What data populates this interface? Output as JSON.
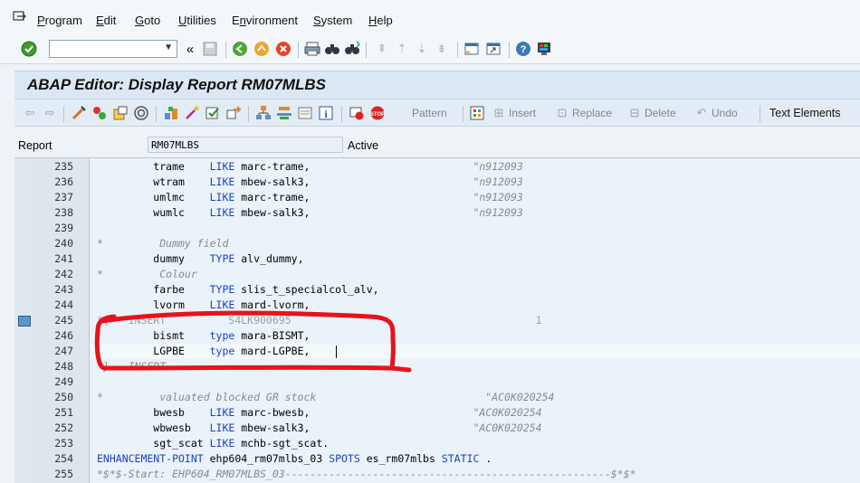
{
  "menubar": {
    "items": [
      "Program",
      "Edit",
      "Goto",
      "Utilities",
      "Environment",
      "System",
      "Help"
    ],
    "underlines": [
      "P",
      "E",
      "G",
      "U",
      "n",
      "S",
      "H"
    ]
  },
  "toolbar1": {
    "command_field": {
      "value": "",
      "placeholder": ""
    },
    "icons": [
      "enter-icon",
      "save-icon",
      "back-icon",
      "exit-icon",
      "cancel-icon",
      "print-icon",
      "find-icon",
      "find-next-icon",
      "first-page-icon",
      "prev-page-icon",
      "next-page-icon",
      "last-page-icon",
      "new-session-icon",
      "shortcut-icon",
      "help-icon",
      "customize-layout-icon"
    ]
  },
  "title": "ABAP Editor: Display Report RM07MLBS",
  "toolbar2": {
    "pattern_label": "Pattern",
    "insert_label": "Insert",
    "replace_label": "Replace",
    "delete_label": "Delete",
    "undo_label": "Undo",
    "text_elements_label": "Text Elements"
  },
  "report": {
    "label": "Report",
    "value": "RM07MLBS",
    "status": "Active"
  },
  "editor": {
    "lines": [
      {
        "n": "235",
        "parts": [
          [
            "",
            "         trame    "
          ],
          [
            "kw",
            "LIKE"
          ],
          [
            "",
            " marc-trame,"
          ],
          [
            "",
            "                          "
          ],
          [
            "cm",
            "\"n912093"
          ]
        ]
      },
      {
        "n": "236",
        "parts": [
          [
            "",
            "         wtram    "
          ],
          [
            "kw",
            "LIKE"
          ],
          [
            "",
            " mbew-salk3,"
          ],
          [
            "",
            "                          "
          ],
          [
            "cm",
            "\"n912093"
          ]
        ]
      },
      {
        "n": "237",
        "parts": [
          [
            "",
            "         umlmc    "
          ],
          [
            "kw",
            "LIKE"
          ],
          [
            "",
            " marc-trame,"
          ],
          [
            "",
            "                          "
          ],
          [
            "cm",
            "\"n912093"
          ]
        ]
      },
      {
        "n": "238",
        "parts": [
          [
            "",
            "         wumlc    "
          ],
          [
            "kw",
            "LIKE"
          ],
          [
            "",
            " mbew-salk3,"
          ],
          [
            "",
            "                          "
          ],
          [
            "cm",
            "\"n912093"
          ]
        ]
      },
      {
        "n": "239",
        "parts": [
          [
            "",
            ""
          ]
        ]
      },
      {
        "n": "240",
        "parts": [
          [
            "cm",
            "*         Dummy field"
          ]
        ]
      },
      {
        "n": "241",
        "parts": [
          [
            "",
            "         dummy    "
          ],
          [
            "kw",
            "TYPE"
          ],
          [
            "",
            " alv_dummy,"
          ]
        ]
      },
      {
        "n": "242",
        "parts": [
          [
            "cm",
            "*         Colour"
          ]
        ]
      },
      {
        "n": "243",
        "parts": [
          [
            "",
            "         farbe    "
          ],
          [
            "kw",
            "TYPE"
          ],
          [
            "",
            " slis_t_specialcol_alv,"
          ]
        ]
      },
      {
        "n": "244",
        "parts": [
          [
            "",
            "         lvorm    "
          ],
          [
            "kw",
            "LIKE"
          ],
          [
            "",
            " mard-lvorm,"
          ]
        ]
      },
      {
        "n": "245",
        "parts": [
          [
            "dimcm",
            "*{   INSERT          S4LK900695                                       1"
          ]
        ]
      },
      {
        "n": "246",
        "parts": [
          [
            "",
            "         bismt    "
          ],
          [
            "kw",
            "type"
          ],
          [
            "",
            " mara-BISMT,"
          ]
        ]
      },
      {
        "n": "247",
        "parts": [
          [
            "",
            "         LGPBE    "
          ],
          [
            "kw",
            "type"
          ],
          [
            "",
            " mard-LGPBE,"
          ]
        ]
      },
      {
        "n": "248",
        "parts": [
          [
            "cm",
            "*}   INSERT"
          ]
        ]
      },
      {
        "n": "249",
        "parts": [
          [
            "",
            ""
          ]
        ]
      },
      {
        "n": "250",
        "parts": [
          [
            "cm",
            "*         valuated blocked GR stock                           \"AC0K020254"
          ]
        ]
      },
      {
        "n": "251",
        "parts": [
          [
            "",
            "         bwesb    "
          ],
          [
            "kw",
            "LIKE"
          ],
          [
            "",
            " marc-bwesb,"
          ],
          [
            "",
            "                          "
          ],
          [
            "cm",
            "\"AC0K020254"
          ]
        ]
      },
      {
        "n": "252",
        "parts": [
          [
            "",
            "         wbwesb   "
          ],
          [
            "kw",
            "LIKE"
          ],
          [
            "",
            " mbew-salk3,"
          ],
          [
            "",
            "                          "
          ],
          [
            "cm",
            "\"AC0K020254"
          ]
        ]
      },
      {
        "n": "253",
        "parts": [
          [
            "",
            "         sgt_scat "
          ],
          [
            "kw",
            "LIKE"
          ],
          [
            "",
            " mchb-sgt_scat."
          ]
        ]
      },
      {
        "n": "254",
        "parts": [
          [
            "kw",
            "ENHANCEMENT-POINT"
          ],
          [
            "",
            " ehp604_rm07mlbs_03 "
          ],
          [
            "kw",
            "SPOTS"
          ],
          [
            "",
            " es_rm07mlbs "
          ],
          [
            "kw",
            "STATIC"
          ],
          [
            "",
            " ."
          ]
        ]
      },
      {
        "n": "255",
        "parts": [
          [
            "cm",
            "*$*$-Start: EHP604_RM07MLBS_03----------------------------------------------------$*$*"
          ]
        ]
      }
    ]
  },
  "colors": {
    "keyword": "#1b3fc6",
    "comment": "#8a8a8a",
    "annotation": "#e8121b",
    "title_bg": "#dbe8f4",
    "editor_bg": "#eaf3f9"
  }
}
